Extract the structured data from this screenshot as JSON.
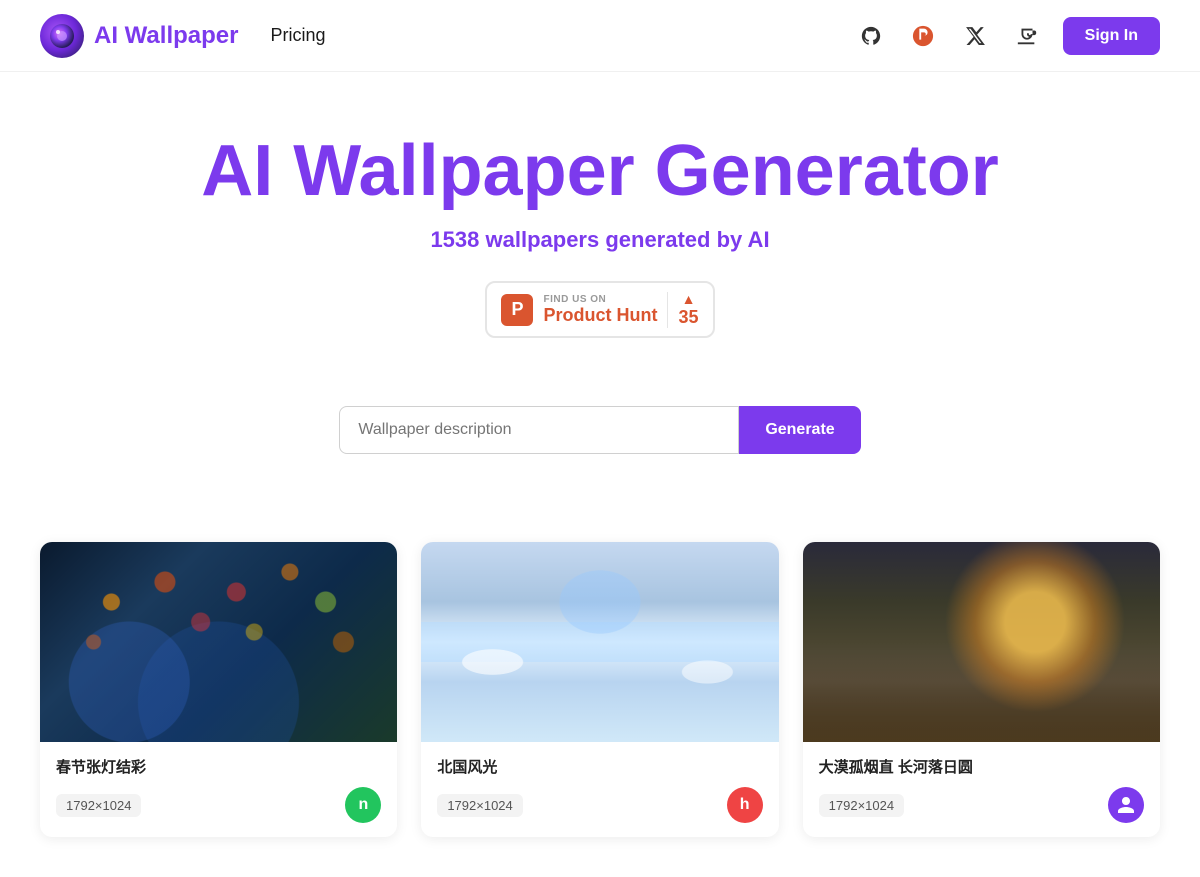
{
  "header": {
    "logo_text": "AI Wallpaper",
    "nav": [
      {
        "label": "Pricing",
        "href": "#pricing"
      }
    ],
    "icons": [
      "github",
      "producthunt",
      "x",
      "coffee"
    ],
    "signin_label": "Sign In"
  },
  "hero": {
    "title": "AI Wallpaper Generator",
    "subtitle_count": "1538",
    "subtitle_rest": " wallpapers generated by AI",
    "product_hunt": {
      "find_us": "FIND US ON",
      "name": "Product Hunt",
      "score": "35"
    },
    "search_placeholder": "Wallpaper description",
    "generate_label": "Generate"
  },
  "gallery": {
    "items": [
      {
        "title": "春节张灯结彩",
        "size": "1792×1024",
        "avatar_letter": "n",
        "avatar_color": "green",
        "img_class": "img-lanterns"
      },
      {
        "title": "北国风光",
        "size": "1792×1024",
        "avatar_letter": "h",
        "avatar_color": "red",
        "img_class": "img-winter"
      },
      {
        "title": "大漠孤烟直 长河落日圆",
        "size": "1792×1024",
        "avatar_letter": "",
        "avatar_color": "purple",
        "img_class": "img-desert"
      }
    ]
  }
}
